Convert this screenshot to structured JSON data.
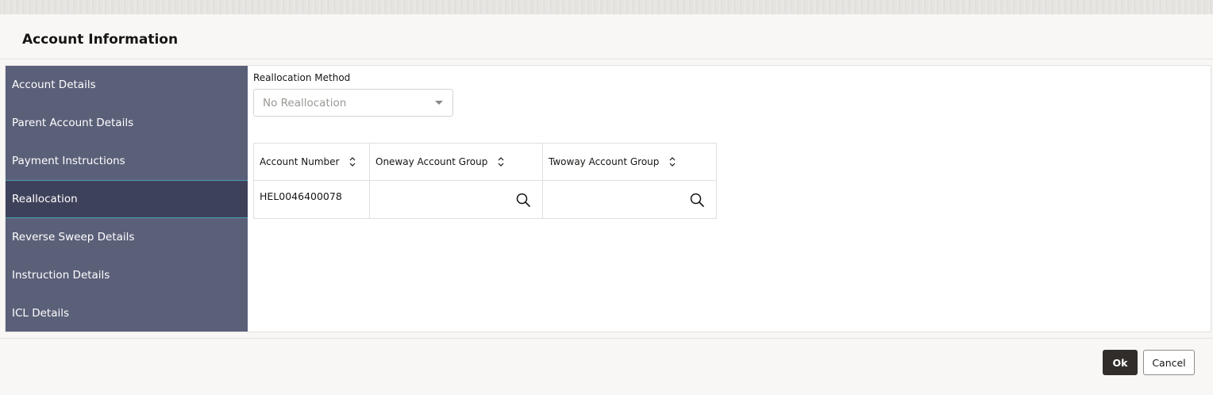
{
  "dialog": {
    "title": "Account Information"
  },
  "sidebar": {
    "items": [
      {
        "label": "Account Details"
      },
      {
        "label": "Parent Account Details"
      },
      {
        "label": "Payment Instructions"
      },
      {
        "label": "Reallocation",
        "active": true
      },
      {
        "label": "Reverse Sweep Details"
      },
      {
        "label": "Instruction Details"
      },
      {
        "label": "ICL Details"
      }
    ]
  },
  "form": {
    "reallocation_method_label": "Reallocation Method",
    "reallocation_method_value": "No Reallocation"
  },
  "table": {
    "columns": [
      "Account Number",
      "Oneway Account Group",
      "Twoway Account Group"
    ],
    "rows": [
      {
        "account_number": "HEL0046400078",
        "oneway_account_group": "",
        "twoway_account_group": ""
      }
    ]
  },
  "footer": {
    "ok_label": "Ok",
    "cancel_label": "Cancel"
  },
  "icons": {
    "sort": "sort-icon",
    "lov": "search-icon",
    "caret": "chevron-down-icon"
  },
  "colors": {
    "sidebar_bg": "#5b6079",
    "sidebar_active_bg": "#3e415a",
    "sidebar_active_border": "#4a9cb8",
    "primary_button": "#312d2a"
  }
}
